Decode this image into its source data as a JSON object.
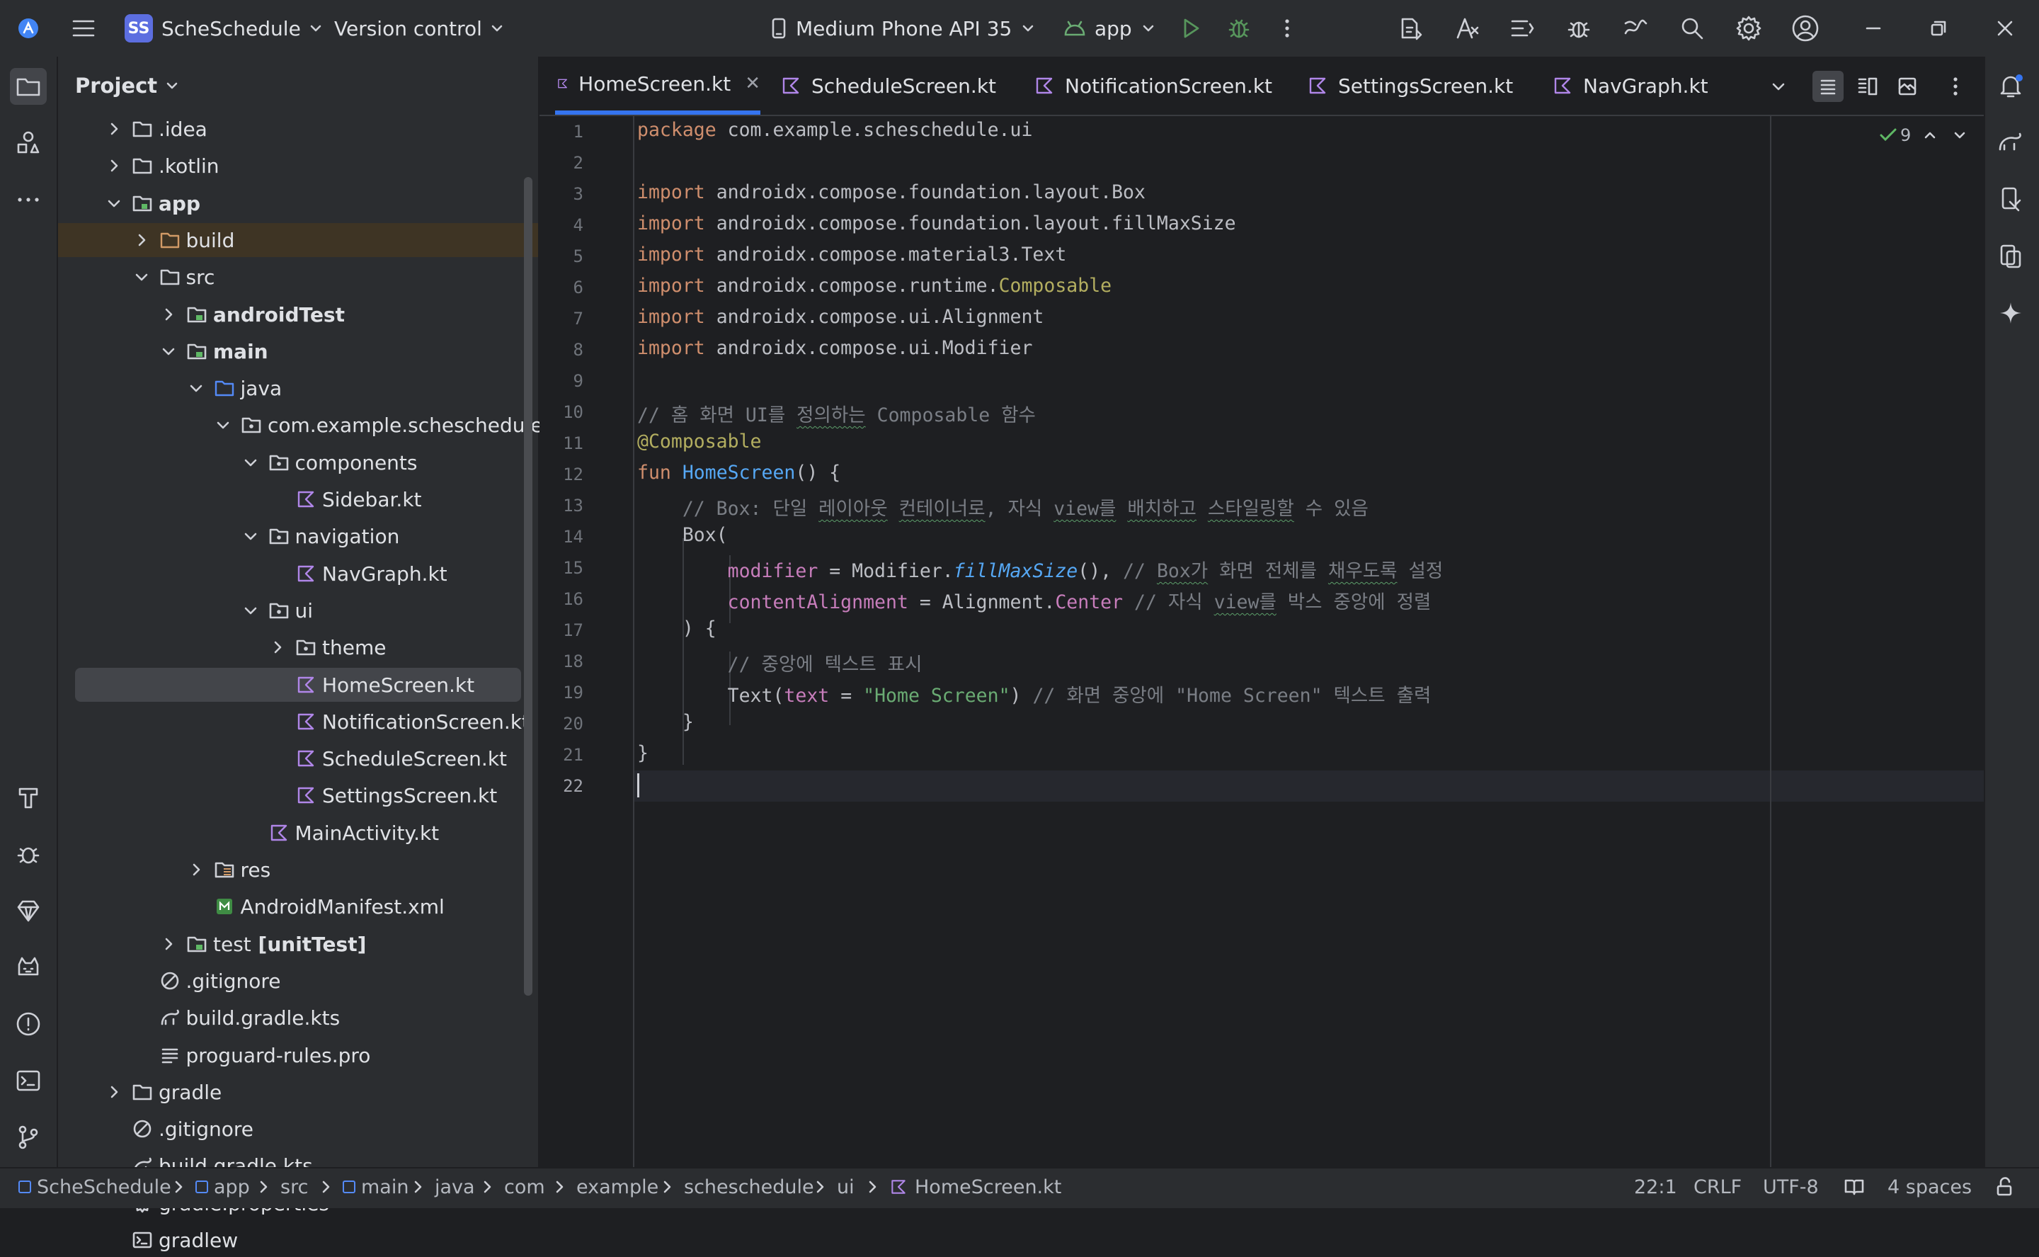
{
  "titlebar": {
    "project_badge": "SS",
    "project_name": "ScheSchedule",
    "vcs": "Version control",
    "device": "Medium Phone API 35",
    "run_config": "app",
    "fold_count": "9"
  },
  "project_panel": {
    "title": "Project",
    "tree": [
      {
        "label": ".idea"
      },
      {
        "label": ".kotlin"
      },
      {
        "label": "app"
      },
      {
        "label": "build"
      },
      {
        "label": "src"
      },
      {
        "label": "androidTest"
      },
      {
        "label": "main"
      },
      {
        "label": "java"
      },
      {
        "label": "com.example.scheschedule"
      },
      {
        "label": "components"
      },
      {
        "label": "Sidebar.kt"
      },
      {
        "label": "navigation"
      },
      {
        "label": "NavGraph.kt"
      },
      {
        "label": "ui"
      },
      {
        "label": "theme"
      },
      {
        "label": "HomeScreen.kt"
      },
      {
        "label": "NotificationScreen.kt"
      },
      {
        "label": "ScheduleScreen.kt"
      },
      {
        "label": "SettingsScreen.kt"
      },
      {
        "label": "MainActivity.kt"
      },
      {
        "label": "res"
      },
      {
        "label": "AndroidManifest.xml"
      },
      {
        "label": "test",
        "suffix": " [unitTest]"
      },
      {
        "label": ".gitignore"
      },
      {
        "label": "build.gradle.kts"
      },
      {
        "label": "proguard-rules.pro"
      },
      {
        "label": "gradle"
      },
      {
        "label": ".gitignore"
      },
      {
        "label": "build.gradle.kts"
      },
      {
        "label": "gradle.properties"
      },
      {
        "label": "gradlew"
      }
    ]
  },
  "tabs": [
    {
      "label": "HomeScreen.kt",
      "active": true
    },
    {
      "label": "ScheduleScreen.kt"
    },
    {
      "label": "NotificationScreen.kt"
    },
    {
      "label": "SettingsScreen.kt"
    },
    {
      "label": "NavGraph.kt"
    }
  ],
  "editor": {
    "line_numbers": [
      "1",
      "2",
      "3",
      "4",
      "5",
      "6",
      "7",
      "8",
      "9",
      "10",
      "11",
      "12",
      "13",
      "14",
      "15",
      "16",
      "17",
      "18",
      "19",
      "20",
      "21",
      "22"
    ],
    "code": {
      "l1_kw": "package",
      "l1_rest": " com.example.scheschedule.ui",
      "l3_kw": "import",
      "l3_rest": " androidx.compose.foundation.layout.Box",
      "l4_kw": "import",
      "l4_rest": " androidx.compose.foundation.layout.fillMaxSize",
      "l5_kw": "import",
      "l5_rest": " androidx.compose.material3.Text",
      "l6_kw": "import",
      "l6_rest": " androidx.compose.runtime.",
      "l6_an": "Composable",
      "l7_kw": "import",
      "l7_rest": " androidx.compose.ui.Alignment",
      "l8_kw": "import",
      "l8_rest": " androidx.compose.ui.Modifier",
      "l10_a": "// 홈 화면 UI를 ",
      "l10_sq": "정의하는",
      "l10_b": " Composable 함수",
      "l11": "@Composable",
      "l12_kw": "fun",
      "l12_fn": " HomeScreen",
      "l12_rest": "() {",
      "l13_a": "    // Box: 단일 ",
      "l13_sq1": "레이아웃",
      "l13_sp1": " ",
      "l13_sq2": "컨테이너로",
      "l13_b": ", 자식 ",
      "l13_sq3": "view를",
      "l13_sp2": " ",
      "l13_sq4": "배치하고",
      "l13_sp3": " ",
      "l13_sq5": "스타일링할",
      "l13_c": " 수 있음",
      "l14": "    Box(",
      "l15_ind": "        ",
      "l15_pr": "modifier",
      "l15_eq": " = Modifier.",
      "l15_it": "fillMaxSize",
      "l15_r": "(), ",
      "l15_cm": "// ",
      "l15_sq1": "Box가",
      "l15_cm2": " 화면 전체를 ",
      "l15_sq2": "채우도록",
      "l15_cm3": " 설정",
      "l16_ind": "        ",
      "l16_pr": "contentAlignment",
      "l16_eq": " = Alignment.",
      "l16_pr2": "Center",
      "l16_cm": " // 자식 ",
      "l16_sq": "view를",
      "l16_cm2": " 박스 중앙에 정렬",
      "l17": "    ) {",
      "l18": "        // 중앙에 텍스트 표시",
      "l19_a": "        Text(",
      "l19_pr": "text",
      "l19_eq": " = ",
      "l19_st": "\"Home Screen\"",
      "l19_r": ") ",
      "l19_cm": "// 화면 중앙에 \"Home Screen\" 텍스트 출력",
      "l20": "    }",
      "l21": "}"
    }
  },
  "statusbar": {
    "breadcrumbs": [
      "ScheSchedule",
      "app",
      "src",
      "main",
      "java",
      "com",
      "example",
      "scheschedule",
      "ui",
      "HomeScreen.kt"
    ],
    "position": "22:1",
    "line_sep": "CRLF",
    "encoding": "UTF-8",
    "indent": "4 spaces"
  },
  "colors": {
    "accent": "#3574f0",
    "keyword": "#cf8e6d",
    "function": "#56a8f5",
    "property": "#c77dbb",
    "string": "#6aab73",
    "annotation": "#b3ae60",
    "comment": "#7a7e85"
  }
}
